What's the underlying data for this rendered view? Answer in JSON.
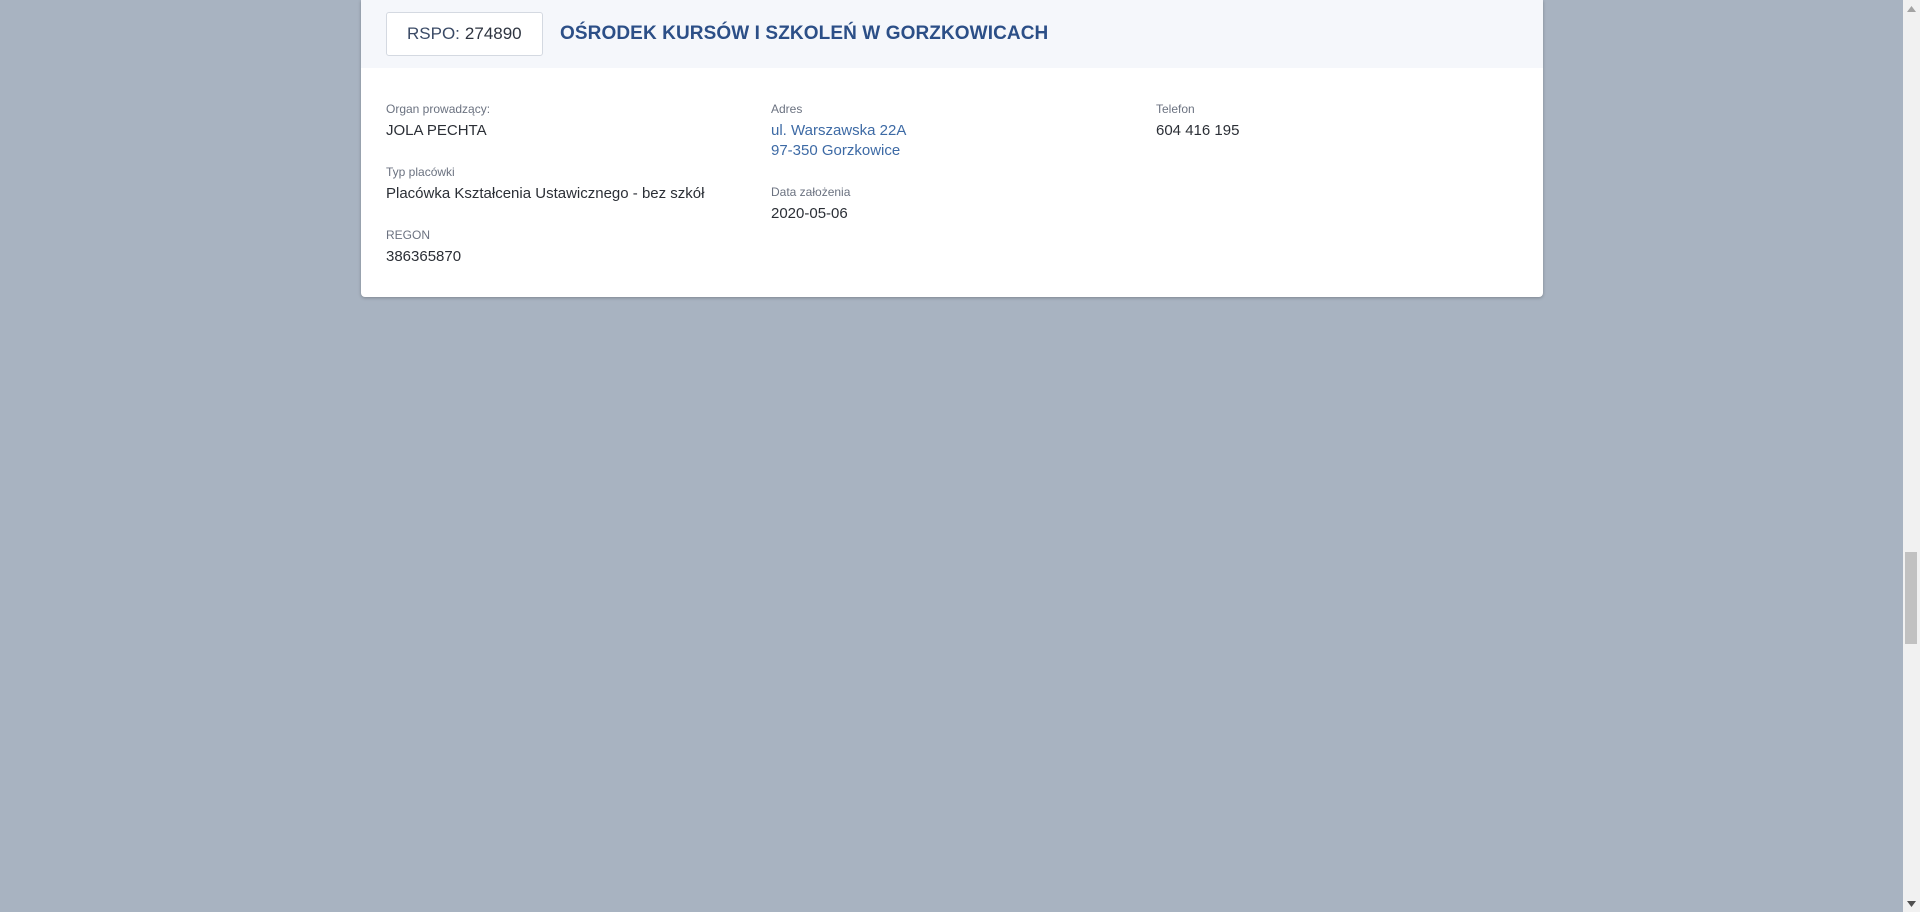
{
  "card": {
    "rspo_label": "RSPO:",
    "rspo_number": "274890",
    "title": "OŚRODEK KURSÓW I SZKOLEŃ W GORZKOWICACH"
  },
  "fields": {
    "organ": {
      "label": "Organ prowadzący:",
      "value": "JOLA PECHTA"
    },
    "typ": {
      "label": "Typ placówki",
      "value": "Placówka Kształcenia Ustawicznego - bez szkół"
    },
    "regon": {
      "label": "REGON",
      "value": "386365870"
    },
    "adres": {
      "label": "Adres",
      "line1": "ul. Warszawska 22A",
      "line2": "97-350 Gorzkowice"
    },
    "data": {
      "label": "Data założenia",
      "value": "2020-05-06"
    },
    "telefon": {
      "label": "Telefon",
      "value": "604 416 195"
    }
  },
  "colors": {
    "background": "#a8b3c1",
    "title": "#2c4f87",
    "link": "#3d6aa5",
    "header_bg": "#f5f7fb"
  },
  "icons": {
    "scroll_up": "triangle-up",
    "scroll_down": "triangle-down"
  }
}
